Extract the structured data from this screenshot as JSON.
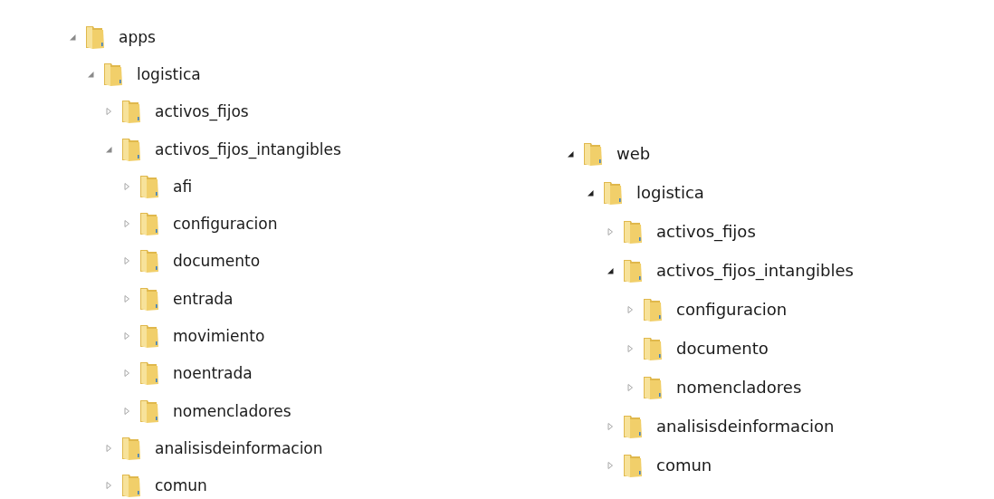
{
  "trees": [
    {
      "items": [
        {
          "label": "apps",
          "expanded": true,
          "children": [
            {
              "label": "logistica",
              "expanded": true,
              "children": [
                {
                  "label": "activos_fijos",
                  "expanded": false
                },
                {
                  "label": "activos_fijos_intangibles",
                  "expanded": true,
                  "children": [
                    {
                      "label": "afi",
                      "expanded": false
                    },
                    {
                      "label": "configuracion",
                      "expanded": false
                    },
                    {
                      "label": "documento",
                      "expanded": false
                    },
                    {
                      "label": "entrada",
                      "expanded": false
                    },
                    {
                      "label": "movimiento",
                      "expanded": false
                    },
                    {
                      "label": "noentrada",
                      "expanded": false
                    },
                    {
                      "label": "nomencladores",
                      "expanded": false
                    }
                  ]
                },
                {
                  "label": "analisisdeinformacion",
                  "expanded": false
                },
                {
                  "label": "comun",
                  "expanded": false
                }
              ]
            }
          ]
        }
      ]
    },
    {
      "items": [
        {
          "label": "web",
          "expanded": true,
          "children": [
            {
              "label": "logistica",
              "expanded": true,
              "children": [
                {
                  "label": "activos_fijos",
                  "expanded": false
                },
                {
                  "label": "activos_fijos_intangibles",
                  "expanded": true,
                  "children": [
                    {
                      "label": "configuracion",
                      "expanded": false
                    },
                    {
                      "label": "documento",
                      "expanded": false
                    },
                    {
                      "label": "nomencladores",
                      "expanded": false
                    }
                  ]
                },
                {
                  "label": "analisisdeinformacion",
                  "expanded": false
                },
                {
                  "label": "comun",
                  "expanded": false
                }
              ]
            }
          ]
        }
      ]
    }
  ]
}
